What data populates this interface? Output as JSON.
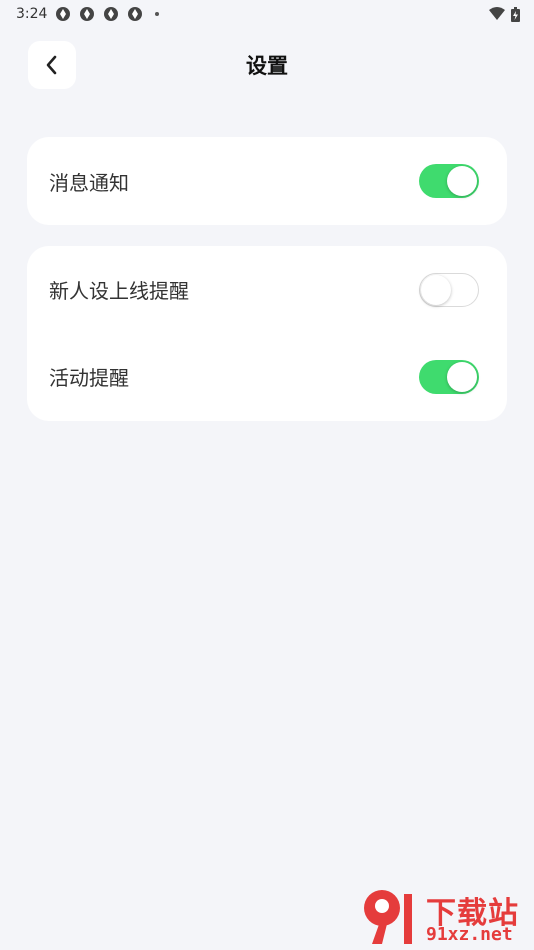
{
  "status_bar": {
    "time": "3:24",
    "icons": [
      "app-notification-icon",
      "app-notification-icon",
      "app-notification-icon",
      "app-notification-icon",
      "dot-icon"
    ],
    "right_icons": [
      "wifi-icon",
      "battery-icon"
    ]
  },
  "header": {
    "title": "设置",
    "back_icon": "chevron-left-icon"
  },
  "settings": {
    "group1": [
      {
        "label": "消息通知",
        "enabled": true
      }
    ],
    "group2": [
      {
        "label": "新人设上线提醒",
        "enabled": false
      },
      {
        "label": "活动提醒",
        "enabled": true
      }
    ]
  },
  "watermark": {
    "line1": "下载站",
    "line2": "91xz.net"
  },
  "colors": {
    "background": "#f4f5f9",
    "card": "#ffffff",
    "toggle_on": "#3fdb6e",
    "watermark": "#e53c3c"
  }
}
